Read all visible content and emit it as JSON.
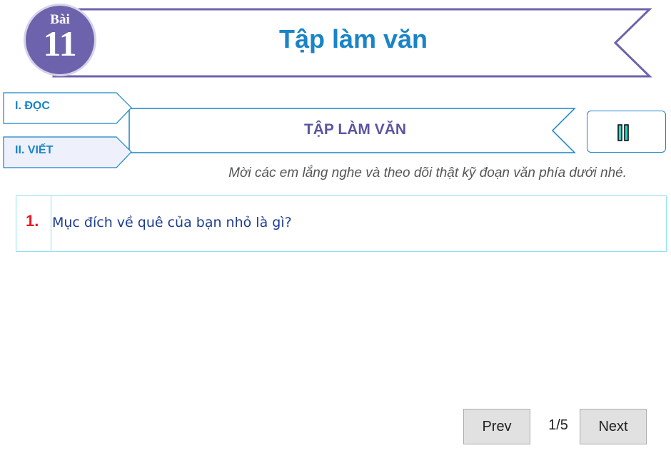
{
  "header": {
    "lesson_word": "Bài",
    "lesson_number": "11",
    "title": "Tập làm văn"
  },
  "nav": [
    {
      "label": "I. ĐỌC"
    },
    {
      "label": "II. VIẾT"
    }
  ],
  "section": {
    "title": "TẬP LÀM VĂN",
    "pause_icon": "pause-icon"
  },
  "instruction": "Mời các em lắng nghe và theo dõi thật kỹ đoạn văn phía dưới nhé.",
  "question": {
    "number": "1.",
    "text": "Mục đích về quê của bạn nhỏ là gì?"
  },
  "pagination": {
    "prev_label": "Prev",
    "indicator": "1/5",
    "next_label": "Next"
  },
  "colors": {
    "brand_purple": "#6d63ac",
    "accent_blue": "#1a84c7",
    "question_number_red": "#e31b23"
  }
}
